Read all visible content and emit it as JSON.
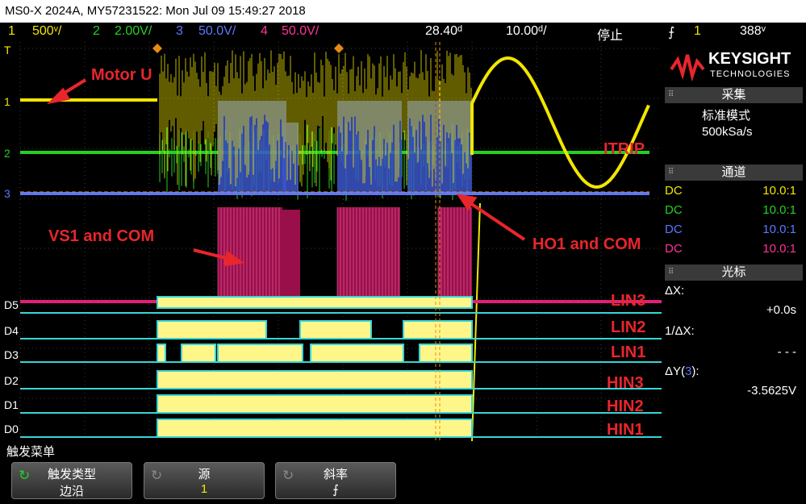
{
  "title": "MS0-X 2024A, MY57231522: Mon Jul 09 15:49:27 2018",
  "topbar": {
    "ch1_num": "1",
    "ch1_scale": "500ᵛ/",
    "ch2_num": "2",
    "ch2_scale": "2.00V/",
    "ch3_num": "3",
    "ch3_scale": "50.0V/",
    "ch4_num": "4",
    "ch4_scale": "50.0V/",
    "time_delay": "28.40ᵈ",
    "time_scale": "10.00ᵈ/",
    "run_state": "停止",
    "trigger_icon": "rising-edge-icon",
    "trigger_src": "1",
    "trigger_level": "388ᵛ"
  },
  "brand": {
    "name": "KEYSIGHT",
    "sub": "TECHNOLOGIES"
  },
  "acquire": {
    "header": "采集",
    "mode": "标准模式",
    "rate": "500kSa/s"
  },
  "channels": {
    "header": "通道",
    "rows": [
      {
        "coupling": "DC",
        "probe": "10.0:1",
        "color": "#f2e600"
      },
      {
        "coupling": "DC",
        "probe": "10.0:1",
        "color": "#25d025"
      },
      {
        "coupling": "DC",
        "probe": "10.0:1",
        "color": "#5a78ff"
      },
      {
        "coupling": "DC",
        "probe": "10.0:1",
        "color": "#ff3399"
      }
    ]
  },
  "cursors": {
    "header": "光标",
    "dx_label": "ΔX:",
    "dx_value": "+0.0s",
    "inv_label": "1/ΔX:",
    "inv_value": "- - -",
    "dy_label_pre": "ΔY(",
    "dy_ch": "3",
    "dy_label_post": "):",
    "dy_value": "-3.5625V"
  },
  "axis_labels": {
    "trig_marker": "T",
    "ch1": "1",
    "ch2": "2",
    "ch3": "3",
    "d5": "D5",
    "d4": "D4",
    "d3": "D3",
    "d2": "D2",
    "d1": "D1",
    "d0": "D0"
  },
  "annotations": {
    "motor_u": "Motor U",
    "vs1_com": "VS1 and COM",
    "ho1_com": "HO1 and COM",
    "itrip": "ITRIP",
    "lin3": "LIN3",
    "lin2": "LIN2",
    "lin1": "LIN1",
    "hin3": "HIN3",
    "hin2": "HIN2",
    "hin1": "HIN1"
  },
  "menu": {
    "title": "触发菜单",
    "keys": [
      {
        "label": "触发类型",
        "value": "边沿",
        "icon": "rotate-arrow-icon"
      },
      {
        "label": "源",
        "value": "1",
        "icon": "rotate-arrow-icon"
      },
      {
        "label": "斜率",
        "value": "⨍",
        "icon": ""
      }
    ]
  },
  "colors": {
    "ch1": "#f2e600",
    "ch2": "#25d025",
    "ch3": "#5a78ff",
    "ch4": "#d0106a",
    "digital": "#fff68a",
    "digital_edge": "#37d6d6",
    "annotation": "#e8262b"
  }
}
